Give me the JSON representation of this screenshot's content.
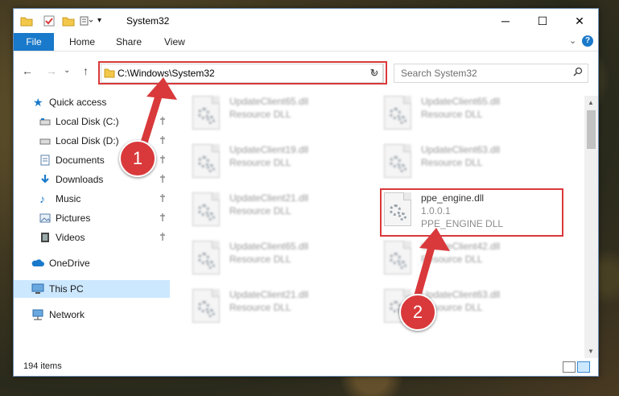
{
  "window": {
    "title": "System32",
    "minimize_glyph": "─",
    "maximize_glyph": "☐",
    "close_glyph": "✕"
  },
  "ribbon": {
    "tabs": [
      "File",
      "Home",
      "Share",
      "View"
    ],
    "expand_glyph": "⌄",
    "help_glyph": "?"
  },
  "address_bar": {
    "path": "C:\\Windows\\System32",
    "back_glyph": "←",
    "forward_glyph": "→",
    "recent_glyph": "⌄",
    "up_glyph": "↑",
    "dropdown_glyph": "⌄",
    "refresh_glyph": "↻"
  },
  "search": {
    "placeholder": "Search System32",
    "icon": "search-icon"
  },
  "sidebar": {
    "items": [
      {
        "label": "Quick access",
        "icon": "star-icon",
        "pinned": false
      },
      {
        "label": "Local Disk (C:)",
        "icon": "drive-icon",
        "pinned": true
      },
      {
        "label": "Local Disk (D:)",
        "icon": "drive-icon",
        "pinned": true
      },
      {
        "label": "Documents",
        "icon": "documents-icon",
        "pinned": true
      },
      {
        "label": "Downloads",
        "icon": "download-icon",
        "pinned": true
      },
      {
        "label": "Music",
        "icon": "music-icon",
        "pinned": true
      },
      {
        "label": "Pictures",
        "icon": "pictures-icon",
        "pinned": true
      },
      {
        "label": "Videos",
        "icon": "videos-icon",
        "pinned": true
      },
      {
        "label": "OneDrive",
        "icon": "cloud-icon",
        "pinned": false
      },
      {
        "label": "This PC",
        "icon": "computer-icon",
        "pinned": false,
        "selected": true
      },
      {
        "label": "Network",
        "icon": "network-icon",
        "pinned": false
      }
    ],
    "pin_glyph": "📌"
  },
  "files": [
    {
      "name": "UpdateClient65.dll",
      "type": "Resource DLL"
    },
    {
      "name": "UpdateClient65.dll",
      "type": "Resource DLL"
    },
    {
      "name": "UpdateClient19.dll",
      "type": "Resource DLL"
    },
    {
      "name": "UpdateClient63.dll",
      "type": "Resource DLL"
    },
    {
      "name": "UpdateClient21.dll",
      "type": "Resource DLL"
    },
    {
      "name": "ppe_engine.dll",
      "version": "1.0.0.1",
      "type": "PPE_ENGINE DLL"
    },
    {
      "name": "UpdateClient65.dll",
      "type": "Resource DLL"
    },
    {
      "name": "UpdateClient42.dll",
      "type": "Resource DLL"
    },
    {
      "name": "UpdateClient21.dll",
      "type": "Resource DLL"
    },
    {
      "name": "UpdateClient63.dll",
      "type": "Resource DLL"
    }
  ],
  "status_bar": {
    "item_count": "194 items"
  },
  "annotations": {
    "marker_1": "1",
    "marker_2": "2",
    "highlight_color": "#d9393b"
  },
  "colors": {
    "accent": "#1979ca",
    "selection": "#cce8ff"
  }
}
